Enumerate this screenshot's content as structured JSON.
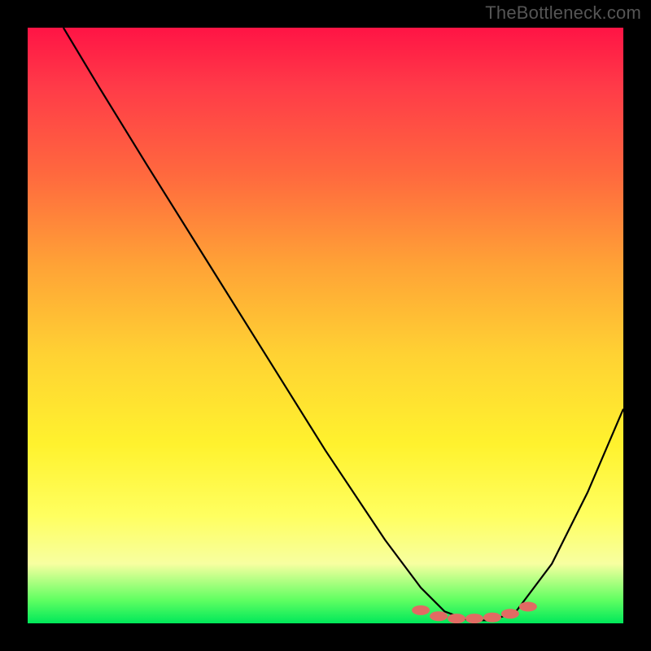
{
  "watermark": "TheBottleneck.com",
  "chart_data": {
    "type": "line",
    "title": "",
    "xlabel": "",
    "ylabel": "",
    "xlim": [
      0,
      100
    ],
    "ylim": [
      0,
      100
    ],
    "legend": false,
    "grid": false,
    "background_gradient": {
      "top": "#ff1445",
      "bottom": "#00e85a",
      "description": "vertical red-to-green through orange/yellow heat gradient"
    },
    "series": [
      {
        "name": "bottleneck-curve",
        "color": "#000000",
        "x": [
          6,
          12,
          20,
          30,
          40,
          50,
          60,
          66,
          70,
          74,
          78,
          82,
          88,
          94,
          100
        ],
        "y": [
          100,
          90,
          77,
          61,
          45,
          29,
          14,
          6,
          2,
          0.5,
          0.5,
          2,
          10,
          22,
          36
        ]
      }
    ],
    "markers": {
      "name": "optimal-range-dots",
      "color": "#e16b63",
      "points": [
        {
          "x": 66,
          "y": 2.2
        },
        {
          "x": 69,
          "y": 1.2
        },
        {
          "x": 72,
          "y": 0.8
        },
        {
          "x": 75,
          "y": 0.8
        },
        {
          "x": 78,
          "y": 1.0
        },
        {
          "x": 81,
          "y": 1.6
        },
        {
          "x": 84,
          "y": 2.8
        }
      ]
    }
  }
}
